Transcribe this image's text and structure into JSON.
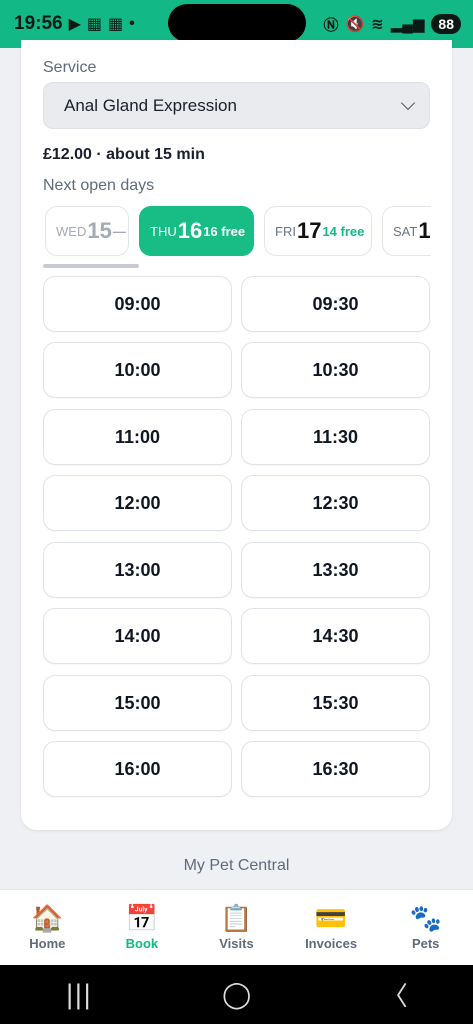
{
  "status_bar": {
    "time": "19:56",
    "left_icons": [
      "play-store-icon",
      "calendar-icon",
      "calendar-icon",
      "dot-icon"
    ],
    "right_icons": [
      "nfc-icon",
      "mute-icon",
      "wifi-icon",
      "signal-icon"
    ],
    "battery": "88"
  },
  "booking": {
    "service_label": "Service",
    "service_value": "Anal Gland Expression",
    "price_duration": "£12.00 · about 15 min",
    "next_days_label": "Next open days",
    "days": [
      {
        "dow": "WED",
        "num": "15",
        "free": "—"
      },
      {
        "dow": "THU",
        "num": "16",
        "free": "16 free"
      },
      {
        "dow": "FRI",
        "num": "17",
        "free": "14 free"
      },
      {
        "dow": "SAT",
        "num": "1",
        "free": ""
      }
    ],
    "slots": [
      "09:00",
      "09:30",
      "10:00",
      "10:30",
      "11:00",
      "11:30",
      "12:00",
      "12:30",
      "13:00",
      "13:30",
      "14:00",
      "14:30",
      "15:00",
      "15:30",
      "16:00",
      "16:30"
    ]
  },
  "footer": {
    "brand": "My Pet Central"
  },
  "nav": {
    "items": [
      {
        "label": "Home",
        "icon": "house-icon"
      },
      {
        "label": "Book",
        "icon": "calendar-icon"
      },
      {
        "label": "Visits",
        "icon": "clipboard-icon"
      },
      {
        "label": "Invoices",
        "icon": "credit-card-icon"
      },
      {
        "label": "Pets",
        "icon": "paw-icon"
      }
    ],
    "active": "Book"
  },
  "colors": {
    "accent": "#12b886",
    "text": "#111722",
    "muted": "#5f6b7a"
  }
}
